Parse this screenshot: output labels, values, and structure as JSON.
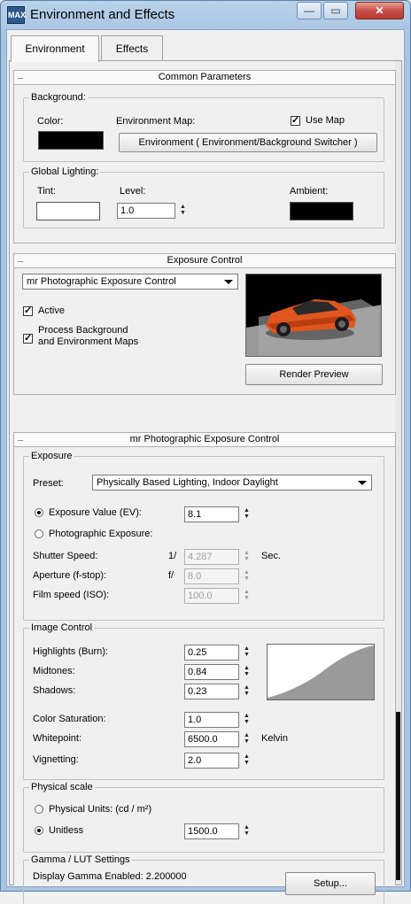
{
  "window": {
    "title": "Environment and Effects",
    "app_icon_text": "MAX"
  },
  "tabs": [
    {
      "label": "Environment"
    },
    {
      "label": "Effects"
    }
  ],
  "common": {
    "header": "Common Parameters",
    "background": {
      "group_title": "Background:",
      "color_label": "Color:",
      "color_value": "#000000",
      "env_map_label": "Environment Map:",
      "use_map_label": "Use Map",
      "use_map_checked": true,
      "env_map_button": "Environment  ( Environment/Background Switcher )"
    },
    "lighting": {
      "group_title": "Global Lighting:",
      "tint_label": "Tint:",
      "tint_value": "#ffffff",
      "level_label": "Level:",
      "level_value": "1.0",
      "ambient_label": "Ambient:",
      "ambient_value": "#000000"
    }
  },
  "exposure": {
    "header": "Exposure Control",
    "selected": "mr Photographic Exposure Control",
    "active_label": "Active",
    "active_checked": true,
    "process_label_1": "Process Background",
    "process_label_2": "and Environment Maps",
    "process_checked": true,
    "render_preview_button": "Render Preview"
  },
  "mr": {
    "header": "mr Photographic Exposure Control",
    "exposure_group": "Exposure",
    "preset_label": "Preset:",
    "preset_value": "Physically Based Lighting, Indoor Daylight",
    "ev_label": "Exposure Value (EV):",
    "ev_value": "8.1",
    "photographic_label": "Photographic Exposure:",
    "shutter_label": "Shutter Speed:",
    "shutter_prefix": "1/",
    "shutter_value": "4.287",
    "shutter_unit": "Sec.",
    "aperture_label": "Aperture (f-stop):",
    "aperture_prefix": "f/",
    "aperture_value": "8.0",
    "iso_label": "Film speed (ISO):",
    "iso_value": "100.0",
    "image_group": "Image Control",
    "highlights_label": "Highlights (Burn):",
    "highlights_value": "0.25",
    "midtones_label": "Midtones:",
    "midtones_value": "0.84",
    "shadows_label": "Shadows:",
    "shadows_value": "0.23",
    "saturation_label": "Color Saturation:",
    "saturation_value": "1.0",
    "whitepoint_label": "Whitepoint:",
    "whitepoint_value": "6500.0",
    "whitepoint_unit": "Kelvin",
    "vignetting_label": "Vignetting:",
    "vignetting_value": "2.0",
    "physical_group": "Physical scale",
    "physical_units_label": "Physical Units: (cd / m²)",
    "unitless_label": "Unitless",
    "unitless_value": "1500.0",
    "gamma_group": "Gamma / LUT Settings",
    "gamma_text": "Display Gamma Enabled:  2.200000",
    "setup_button": "Setup..."
  }
}
